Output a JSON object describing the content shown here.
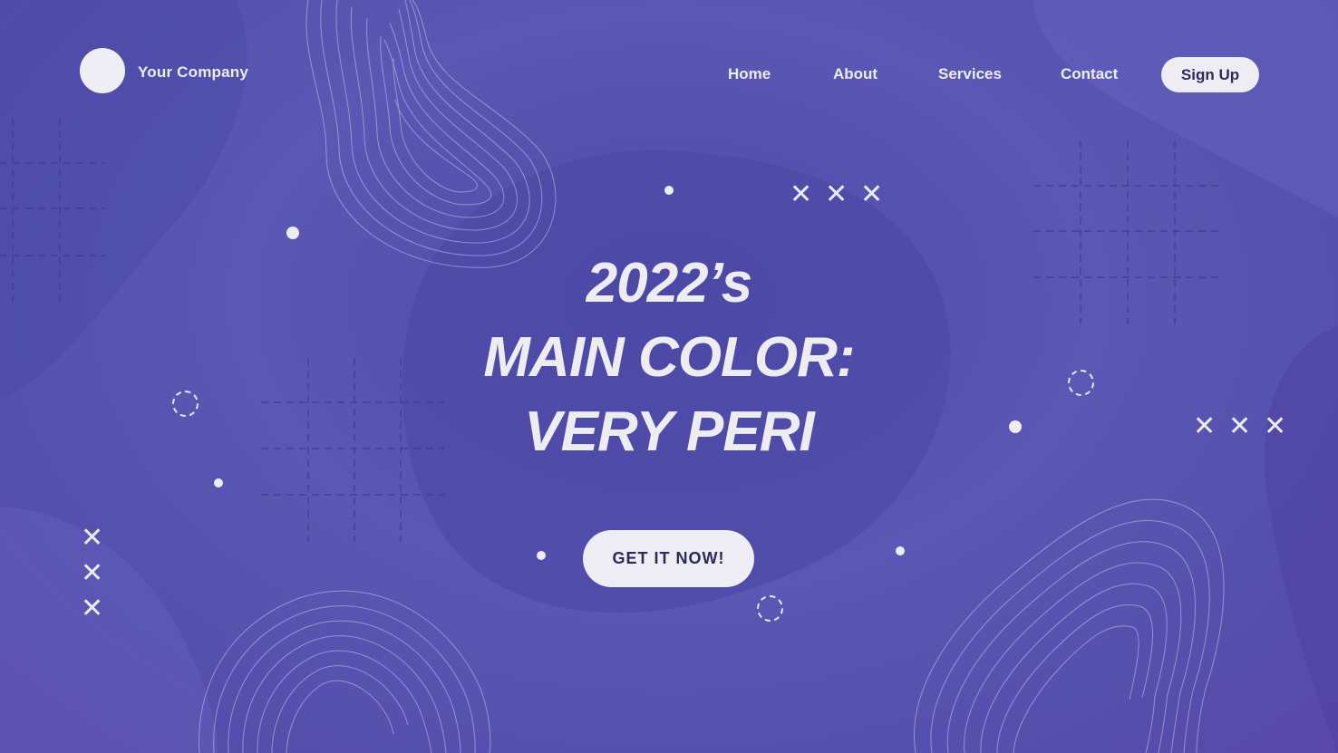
{
  "header": {
    "company_name": "Your Company",
    "nav": [
      {
        "label": "Home"
      },
      {
        "label": "About"
      },
      {
        "label": "Services"
      },
      {
        "label": "Contact"
      }
    ],
    "signup_label": "Sign Up"
  },
  "hero": {
    "line1": "2022’s",
    "line2": "MAIN COLOR:",
    "line3": "VERY PERI",
    "cta_label": "GET IT NOW!"
  },
  "decor": {
    "x_symbol": "✕",
    "logo_icon": "circle-logo"
  },
  "colors": {
    "background": "#5a58b4",
    "accent_light": "#ededf3",
    "button_text": "#2c2a58"
  }
}
